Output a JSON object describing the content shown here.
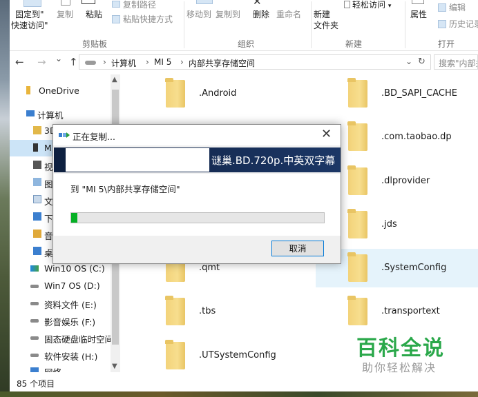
{
  "ribbon": {
    "clipboard": {
      "pin_label_1": "固定到\"",
      "pin_label_2": "快速访问\"",
      "copy": "复制",
      "paste": "粘贴",
      "copy_path": "复制路径",
      "paste_shortcut": "粘贴快捷方式",
      "group": "剪贴板"
    },
    "organize": {
      "move_to": "移动到",
      "copy_to": "复制到",
      "delete": "删除",
      "rename": "重命名",
      "group": "组织"
    },
    "new": {
      "new_folder_1": "新建",
      "new_folder_2": "文件夹",
      "easy_access": "轻松访问",
      "group": "新建"
    },
    "open": {
      "properties": "属性",
      "edit": "编辑",
      "history": "历史记录",
      "group": "打开"
    }
  },
  "address": {
    "back": "←",
    "forward": "→",
    "recent": "⌄",
    "up": "↑",
    "crumbs": [
      "计算机",
      "MI 5",
      "内部共享存储空间"
    ],
    "dropdown": "⌄",
    "refresh": "↻",
    "search_placeholder": "搜索\"内部共享存储空间\""
  },
  "nav_pane": {
    "items": [
      {
        "label": "OneDrive"
      },
      {
        "label": "计算机"
      },
      {
        "label": "3D"
      },
      {
        "label": "MI"
      },
      {
        "label": "视"
      },
      {
        "label": "图"
      },
      {
        "label": "文"
      },
      {
        "label": "下"
      },
      {
        "label": "音"
      },
      {
        "label": "桌"
      },
      {
        "label": "Win10 OS (C:)"
      },
      {
        "label": "Win7 OS (D:)"
      },
      {
        "label": "资料文件 (E:)"
      },
      {
        "label": "影音娱乐 (F:)"
      },
      {
        "label": "固态硬盘临时空间"
      },
      {
        "label": "软件安装 (H:)"
      },
      {
        "label": "网络"
      }
    ]
  },
  "files": [
    {
      "name": ".Android"
    },
    {
      "name": ".BD_SAPI_CACHE"
    },
    {
      "name": ".com.taobao.dp"
    },
    {
      "name": ".dlprovider"
    },
    {
      "name": ".jds"
    },
    {
      "name": ".qmt"
    },
    {
      "name": ".SystemConfig"
    },
    {
      "name": ".tbs"
    },
    {
      "name": ".transportext"
    },
    {
      "name": ".UTSystemConfig"
    }
  ],
  "status_bar": {
    "count": "85 个项目"
  },
  "watermark": {
    "title": "百科全说",
    "subtitle": "助你轻松解决"
  },
  "dialog": {
    "title": "正在复制...",
    "close": "✕",
    "file_name": "谜巢.BD.720p.中英双字幕",
    "destination": "到 \"MI 5\\内部共享存储空间\"",
    "progress": 0.025,
    "cancel": "取消"
  },
  "colors": {
    "accent": "#0078d7",
    "progress": "#06b025",
    "folder": "#f3d37a",
    "selection": "#cce4f7",
    "watermark": "#2aa84a"
  }
}
